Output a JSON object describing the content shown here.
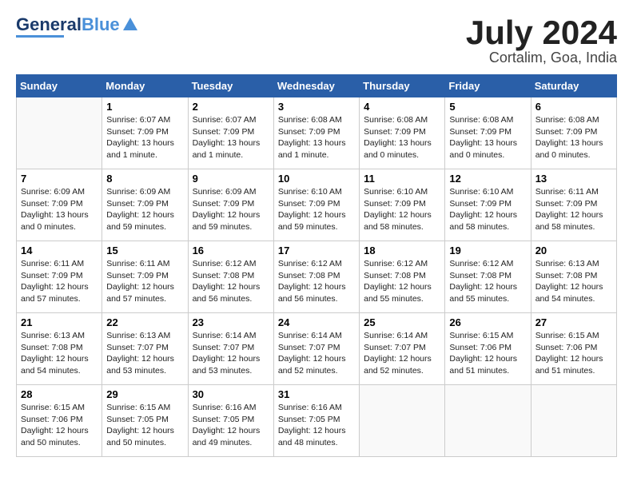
{
  "header": {
    "logo_line1": "General",
    "logo_line2": "Blue",
    "month": "July 2024",
    "location": "Cortalim, Goa, India"
  },
  "weekdays": [
    "Sunday",
    "Monday",
    "Tuesday",
    "Wednesday",
    "Thursday",
    "Friday",
    "Saturday"
  ],
  "weeks": [
    [
      {
        "day": "",
        "info": ""
      },
      {
        "day": "1",
        "info": "Sunrise: 6:07 AM\nSunset: 7:09 PM\nDaylight: 13 hours\nand 1 minute."
      },
      {
        "day": "2",
        "info": "Sunrise: 6:07 AM\nSunset: 7:09 PM\nDaylight: 13 hours\nand 1 minute."
      },
      {
        "day": "3",
        "info": "Sunrise: 6:08 AM\nSunset: 7:09 PM\nDaylight: 13 hours\nand 1 minute."
      },
      {
        "day": "4",
        "info": "Sunrise: 6:08 AM\nSunset: 7:09 PM\nDaylight: 13 hours\nand 0 minutes."
      },
      {
        "day": "5",
        "info": "Sunrise: 6:08 AM\nSunset: 7:09 PM\nDaylight: 13 hours\nand 0 minutes."
      },
      {
        "day": "6",
        "info": "Sunrise: 6:08 AM\nSunset: 7:09 PM\nDaylight: 13 hours\nand 0 minutes."
      }
    ],
    [
      {
        "day": "7",
        "info": "Sunrise: 6:09 AM\nSunset: 7:09 PM\nDaylight: 13 hours\nand 0 minutes."
      },
      {
        "day": "8",
        "info": "Sunrise: 6:09 AM\nSunset: 7:09 PM\nDaylight: 12 hours\nand 59 minutes."
      },
      {
        "day": "9",
        "info": "Sunrise: 6:09 AM\nSunset: 7:09 PM\nDaylight: 12 hours\nand 59 minutes."
      },
      {
        "day": "10",
        "info": "Sunrise: 6:10 AM\nSunset: 7:09 PM\nDaylight: 12 hours\nand 59 minutes."
      },
      {
        "day": "11",
        "info": "Sunrise: 6:10 AM\nSunset: 7:09 PM\nDaylight: 12 hours\nand 58 minutes."
      },
      {
        "day": "12",
        "info": "Sunrise: 6:10 AM\nSunset: 7:09 PM\nDaylight: 12 hours\nand 58 minutes."
      },
      {
        "day": "13",
        "info": "Sunrise: 6:11 AM\nSunset: 7:09 PM\nDaylight: 12 hours\nand 58 minutes."
      }
    ],
    [
      {
        "day": "14",
        "info": "Sunrise: 6:11 AM\nSunset: 7:09 PM\nDaylight: 12 hours\nand 57 minutes."
      },
      {
        "day": "15",
        "info": "Sunrise: 6:11 AM\nSunset: 7:09 PM\nDaylight: 12 hours\nand 57 minutes."
      },
      {
        "day": "16",
        "info": "Sunrise: 6:12 AM\nSunset: 7:08 PM\nDaylight: 12 hours\nand 56 minutes."
      },
      {
        "day": "17",
        "info": "Sunrise: 6:12 AM\nSunset: 7:08 PM\nDaylight: 12 hours\nand 56 minutes."
      },
      {
        "day": "18",
        "info": "Sunrise: 6:12 AM\nSunset: 7:08 PM\nDaylight: 12 hours\nand 55 minutes."
      },
      {
        "day": "19",
        "info": "Sunrise: 6:12 AM\nSunset: 7:08 PM\nDaylight: 12 hours\nand 55 minutes."
      },
      {
        "day": "20",
        "info": "Sunrise: 6:13 AM\nSunset: 7:08 PM\nDaylight: 12 hours\nand 54 minutes."
      }
    ],
    [
      {
        "day": "21",
        "info": "Sunrise: 6:13 AM\nSunset: 7:08 PM\nDaylight: 12 hours\nand 54 minutes."
      },
      {
        "day": "22",
        "info": "Sunrise: 6:13 AM\nSunset: 7:07 PM\nDaylight: 12 hours\nand 53 minutes."
      },
      {
        "day": "23",
        "info": "Sunrise: 6:14 AM\nSunset: 7:07 PM\nDaylight: 12 hours\nand 53 minutes."
      },
      {
        "day": "24",
        "info": "Sunrise: 6:14 AM\nSunset: 7:07 PM\nDaylight: 12 hours\nand 52 minutes."
      },
      {
        "day": "25",
        "info": "Sunrise: 6:14 AM\nSunset: 7:07 PM\nDaylight: 12 hours\nand 52 minutes."
      },
      {
        "day": "26",
        "info": "Sunrise: 6:15 AM\nSunset: 7:06 PM\nDaylight: 12 hours\nand 51 minutes."
      },
      {
        "day": "27",
        "info": "Sunrise: 6:15 AM\nSunset: 7:06 PM\nDaylight: 12 hours\nand 51 minutes."
      }
    ],
    [
      {
        "day": "28",
        "info": "Sunrise: 6:15 AM\nSunset: 7:06 PM\nDaylight: 12 hours\nand 50 minutes."
      },
      {
        "day": "29",
        "info": "Sunrise: 6:15 AM\nSunset: 7:05 PM\nDaylight: 12 hours\nand 50 minutes."
      },
      {
        "day": "30",
        "info": "Sunrise: 6:16 AM\nSunset: 7:05 PM\nDaylight: 12 hours\nand 49 minutes."
      },
      {
        "day": "31",
        "info": "Sunrise: 6:16 AM\nSunset: 7:05 PM\nDaylight: 12 hours\nand 48 minutes."
      },
      {
        "day": "",
        "info": ""
      },
      {
        "day": "",
        "info": ""
      },
      {
        "day": "",
        "info": ""
      }
    ]
  ]
}
